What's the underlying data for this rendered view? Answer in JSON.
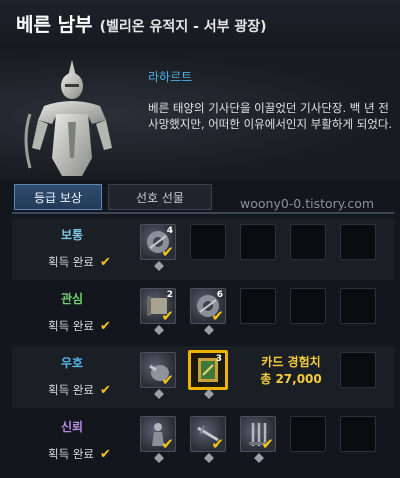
{
  "title": {
    "main": "베른 남부",
    "sub": "(벨리온 유적지 - 서부 광장)"
  },
  "npc": {
    "name": "라하르트",
    "description": "베른 태양의 기사단을 이끌었던 기사단장. 백 년 전 사망했지만, 어떠한 이유에서인지 부활하게 되었다."
  },
  "tabs": [
    {
      "label": "등급 보상",
      "active": true
    },
    {
      "label": "선호 선물",
      "active": false
    }
  ],
  "watermark": "woony0-0.tistory.com",
  "colors": {
    "check": "#f5c518",
    "tab_active": "#2f4c6f",
    "card_highlight": "#f0b400"
  },
  "tiers": [
    {
      "label": "보통",
      "color": "#7ec7e6",
      "status": "획득 완료",
      "slots": [
        {
          "icon": "gear-disc-item",
          "count": "4"
        }
      ]
    },
    {
      "label": "관심",
      "color": "#6fd16f",
      "status": "획득 완료",
      "slots": [
        {
          "icon": "scroll-item",
          "count": "2"
        },
        {
          "icon": "gear-disc-item",
          "count": "6"
        }
      ]
    },
    {
      "label": "우호",
      "color": "#57b7ee",
      "status": "획득 완료",
      "slots": [
        {
          "icon": "pouch-item",
          "count": ""
        },
        {
          "icon": "card-exp-item",
          "count": "3"
        }
      ],
      "card_exp_title": "카드 경험치",
      "card_exp_amount": "총 27,000"
    },
    {
      "label": "신뢰",
      "color": "#b98be0",
      "status": "획득 완료",
      "slots": [
        {
          "icon": "statue-item",
          "count": ""
        },
        {
          "icon": "sword-item",
          "count": ""
        },
        {
          "icon": "weapon-rack-item",
          "count": ""
        }
      ]
    }
  ]
}
